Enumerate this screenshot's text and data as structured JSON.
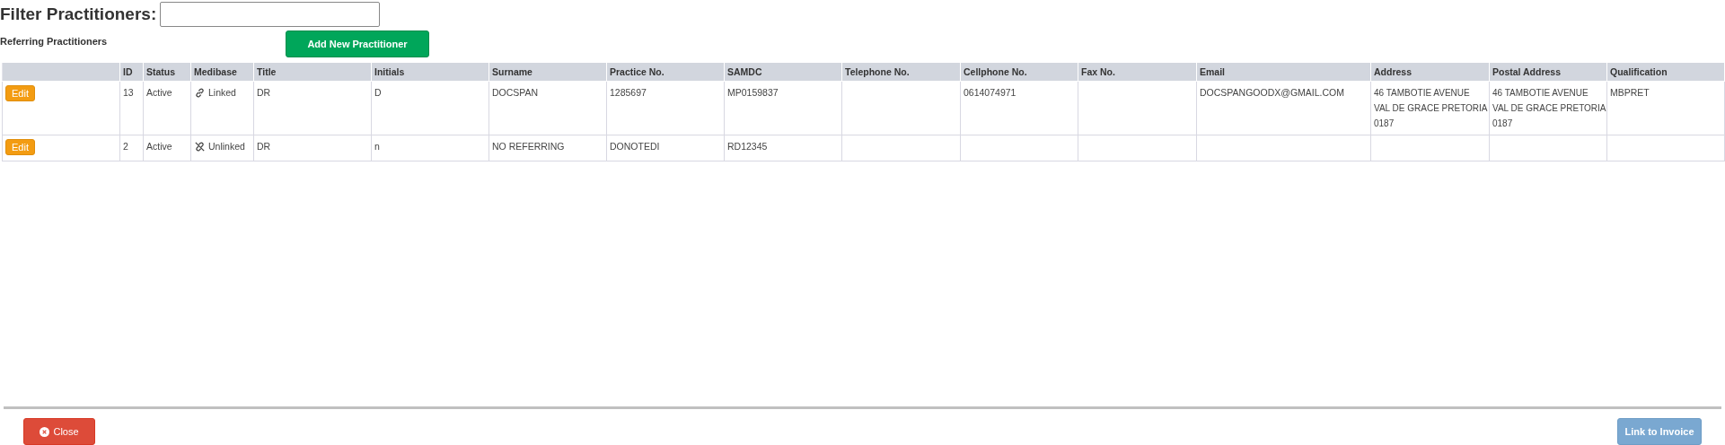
{
  "filter": {
    "label": "Filter Practitioners:"
  },
  "section_title": "Referring Practitioners",
  "add_button": "Add New Practitioner",
  "table": {
    "columns": [
      "",
      "ID",
      "Status",
      "Medibase",
      "Title",
      "Initials",
      "Surname",
      "Practice No.",
      "SAMDC",
      "Telephone No.",
      "Cellphone No.",
      "Fax No.",
      "Email",
      "Address",
      "Postal Address",
      "Qualification"
    ],
    "rows": [
      {
        "action": "Edit",
        "id": "13",
        "status": "Active",
        "linked": true,
        "medibase": "Linked",
        "title": "DR",
        "initials": "D",
        "surname": "DOCSPAN",
        "practice_no": "1285697",
        "samdc": "MP0159837",
        "cellphone": "0614074971",
        "email": "DOCSPANGOODX@GMAIL.COM",
        "address": [
          "46 TAMBOTIE AVENUE",
          "VAL DE GRACE PRETORIA",
          "0187"
        ],
        "postal_address": [
          "46 TAMBOTIE AVENUE",
          "VAL DE GRACE PRETORIA",
          "0187"
        ],
        "qualification": "MBPRET"
      },
      {
        "action": "Edit",
        "id": "2",
        "status": "Active",
        "linked": false,
        "medibase": "Unlinked",
        "title": "DR",
        "initials": "n",
        "surname": "NO REFERRING",
        "practice_no": "DONOTEDI",
        "samdc": "RD12345"
      }
    ]
  },
  "footer": {
    "close": "Close",
    "link": {
      "label": "Link to Invoice",
      "disabled": true
    }
  }
}
